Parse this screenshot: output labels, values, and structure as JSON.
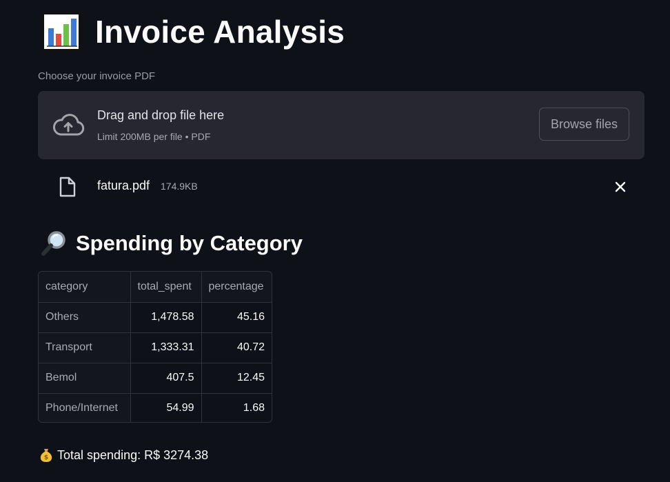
{
  "header": {
    "title": "Invoice Analysis",
    "icon": "bar-chart-icon"
  },
  "uploader": {
    "label": "Choose your invoice PDF",
    "drop_text": "Drag and drop file here",
    "limit_text": "Limit 200MB per file • PDF",
    "browse_label": "Browse files",
    "icon": "cloud-upload-icon"
  },
  "uploaded_file": {
    "name": "fatura.pdf",
    "size": "174.9KB",
    "icon": "file-icon",
    "remove_icon": "close-icon"
  },
  "section": {
    "title": "Spending by Category",
    "icon": "magnifier-icon"
  },
  "table": {
    "columns": [
      "category",
      "total_spent",
      "percentage"
    ],
    "rows": [
      {
        "category": "Others",
        "total_spent": "1,478.58",
        "percentage": "45.16"
      },
      {
        "category": "Transport",
        "total_spent": "1,333.31",
        "percentage": "40.72"
      },
      {
        "category": "Bemol",
        "total_spent": "407.5",
        "percentage": "12.45"
      },
      {
        "category": "Phone/Internet",
        "total_spent": "54.99",
        "percentage": "1.68"
      }
    ]
  },
  "total": {
    "text": "Total spending: R$ 3274.38",
    "icon": "money-bag-icon"
  },
  "colors": {
    "background": "#0e1117",
    "surface": "#262730",
    "text": "#fafafa",
    "muted": "#a9abb1"
  }
}
